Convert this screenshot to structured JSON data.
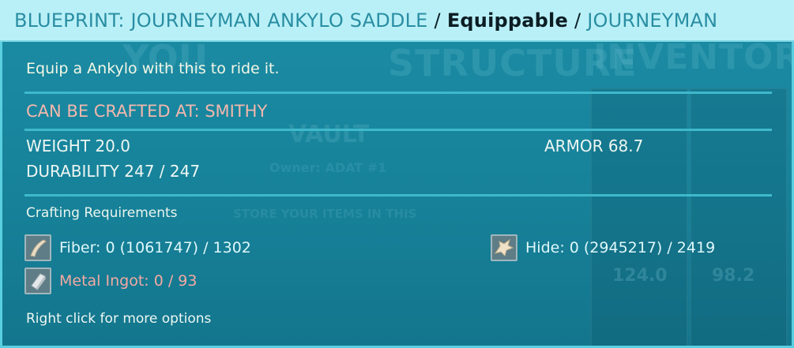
{
  "title": {
    "item_name": "BLUEPRINT: JOURNEYMAN ANKYLO SADDLE",
    "separator": "/",
    "item_type": "Equippable",
    "quality": "JOURNEYMAN"
  },
  "tooltip": {
    "description": "Equip a Ankylo with this to ride it.",
    "crafted_at": "CAN BE CRAFTED AT: SMITHY",
    "weight": "WEIGHT 20.0",
    "armor": "ARMOR 68.7",
    "durability": "DURABILITY 247 / 247",
    "requirements_title": "Crafting Requirements",
    "requirements": [
      {
        "label": "Fiber: 0 (1061747) / 1302",
        "icon": "fiber-icon",
        "status": "ok"
      },
      {
        "label": "Hide: 0 (2945217) / 2419",
        "icon": "hide-icon",
        "status": "ok"
      },
      {
        "label": "Metal Ingot: 0 / 93",
        "icon": "metal-ingot-icon",
        "status": "insufficient"
      }
    ],
    "hint": "Right click for more options"
  },
  "background": {
    "structure_label": "STRUCTURE",
    "inventory_label": "INVENTORY",
    "you_label": "YOU",
    "vault_label": "VAULT",
    "owner_label": "Owner: ADAT #1",
    "store_label": "STORE YOUR ITEMS IN THIS",
    "value_1": "124.0",
    "value_2": "98.2"
  },
  "colors": {
    "title_bg": "#b9f0f7",
    "title_text": "#2a8ea3",
    "panel_bg": "#17839b",
    "border": "#59cfe0",
    "insufficient": "#f3a9a3",
    "crafted_at": "#f3b7ad"
  }
}
